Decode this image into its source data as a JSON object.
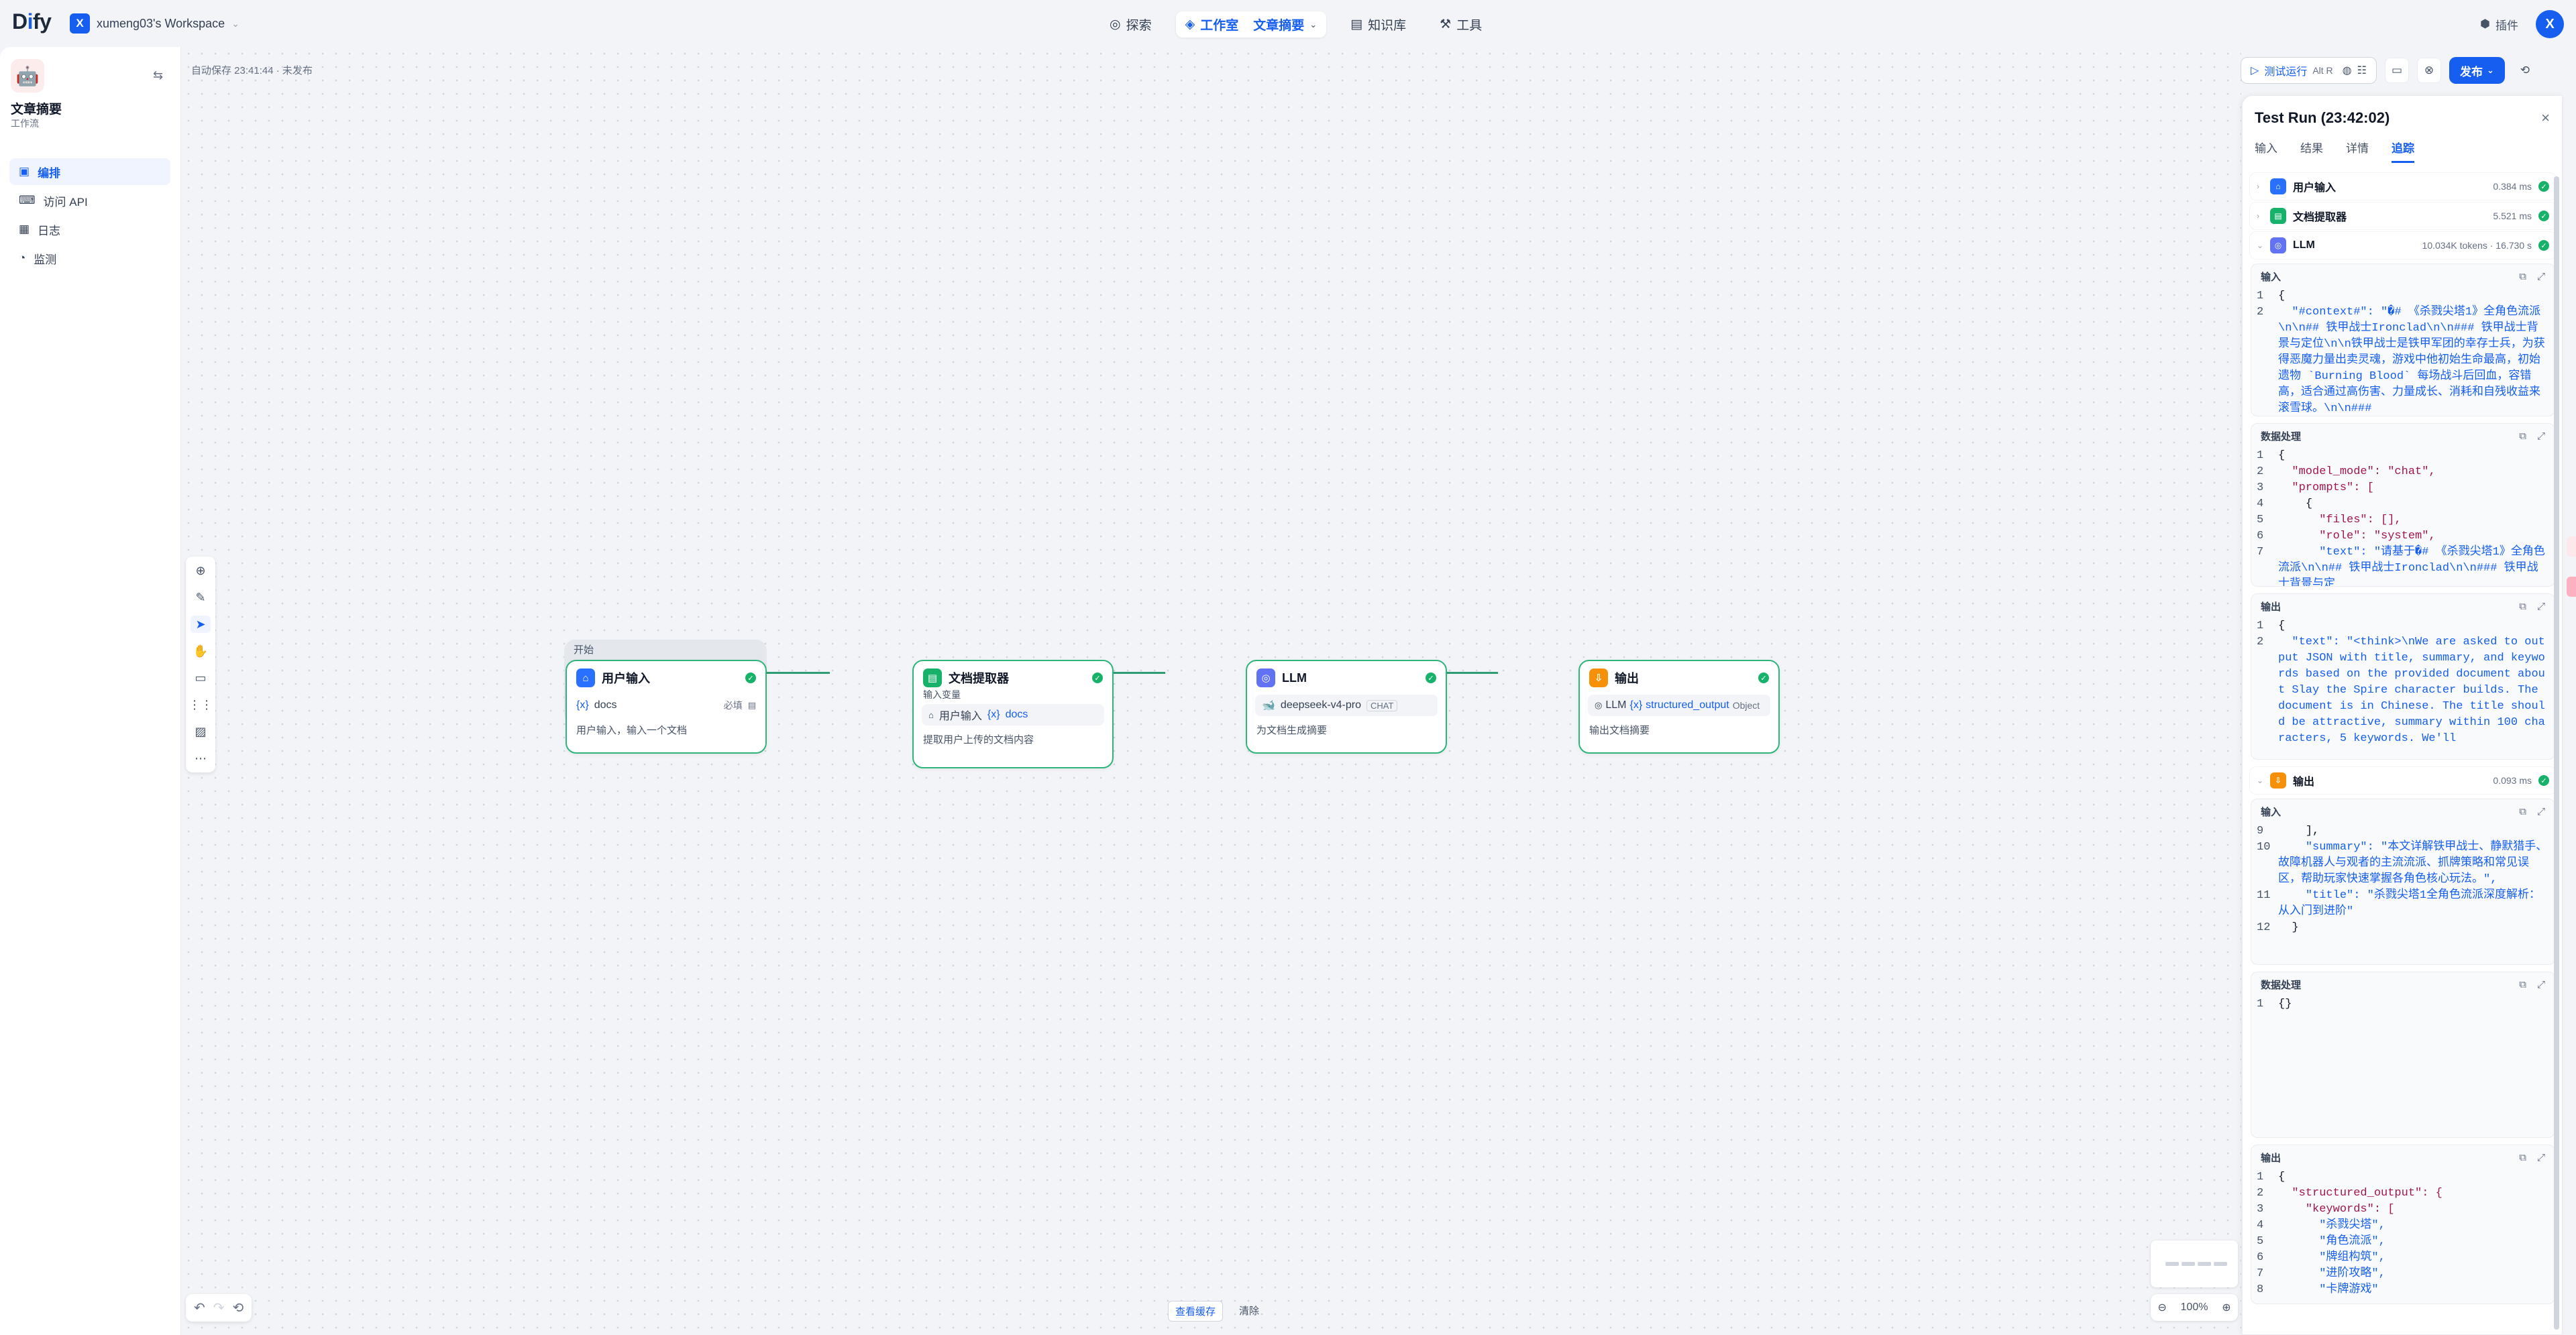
{
  "header": {
    "logo": "Dify",
    "workspace_badge": "X",
    "workspace_name": "xumeng03's Workspace",
    "nav": [
      {
        "label": "探索",
        "icon": "compass-icon"
      },
      {
        "label": "工作室",
        "icon": "studio-icon",
        "sub": "文章摘要"
      },
      {
        "label": "知识库",
        "icon": "book-icon"
      },
      {
        "label": "工具",
        "icon": "tool-icon"
      }
    ],
    "plugins_label": "插件",
    "avatar": "X"
  },
  "sidebar": {
    "app_name": "文章摘要",
    "app_type": "工作流",
    "items": [
      {
        "label": "编排",
        "icon": "layout-icon",
        "active": true
      },
      {
        "label": "访问 API",
        "icon": "terminal-icon",
        "active": false
      },
      {
        "label": "日志",
        "icon": "file-icon",
        "active": false
      },
      {
        "label": "监测",
        "icon": "monitor-icon",
        "active": false
      }
    ]
  },
  "canvas": {
    "autosave": "自动保存 23:41:44 · 未发布",
    "bottom_view_cache": "查看缓存",
    "bottom_clear": "清除",
    "zoom": "100%",
    "start_group_label": "开始",
    "nodes": {
      "user_input": {
        "title": "用户输入",
        "var": "docs",
        "required": "必填",
        "desc": "用户输入，输入一个文档",
        "color": "#2970ff"
      },
      "doc_extractor": {
        "title": "文档提取器",
        "input_label": "输入变量",
        "source": "用户输入",
        "var": "docs",
        "desc": "提取用户上传的文档内容",
        "color": "#17b26a"
      },
      "llm": {
        "title": "LLM",
        "model": "deepseek-v4-pro",
        "mode": "CHAT",
        "desc": "为文档生成摘要",
        "color": "#6172f3"
      },
      "output": {
        "title": "输出",
        "source": "LLM",
        "var": "structured_output",
        "type": "Object",
        "desc": "输出文档摘要",
        "color": "#f79009"
      }
    }
  },
  "right_tools": {
    "test_run": "测试运行",
    "shortcut": "Alt R",
    "publish": "发布"
  },
  "panel": {
    "title": "Test Run (23:42:02)",
    "tabs": [
      "输入",
      "结果",
      "详情",
      "追踪"
    ],
    "active_tab": "追踪",
    "trace": [
      {
        "name": "用户输入",
        "time": "0.384 ms",
        "color": "#2970ff"
      },
      {
        "name": "文档提取器",
        "time": "5.521 ms",
        "color": "#17b26a"
      },
      {
        "name": "LLM",
        "time": "10.034K tokens · 16.730 s",
        "color": "#6172f3"
      },
      {
        "name": "输出",
        "time": "0.093 ms",
        "color": "#f79009"
      }
    ],
    "llm_input_label": "输入",
    "llm_process_label": "数据处理",
    "llm_output_label": "输出",
    "out_input_label": "输入",
    "out_process_label": "数据处理",
    "out_output_label": "输出",
    "llm_input_lines": [
      {
        "n": "1",
        "t": "{"
      },
      {
        "n": "2",
        "t": "  \"#context#\": \"�# 《杀戮尖塔1》全角色流派\\n\\n## 铁甲战士Ironclad\\n\\n### 铁甲战士背景与定位\\n\\n铁甲战士是铁甲军团的幸存士兵，为获得恶魔力量出卖灵魂，游戏中他初始生命最高，初始遗物 `Burning Blood` 每场战斗后回血，容错高，适合通过高伤害、力量成长、消耗和自残收益来滚雪球。\\n\\n###"
      }
    ],
    "llm_process_lines": [
      {
        "n": "1",
        "t": "{"
      },
      {
        "n": "2",
        "t": "  \"model_mode\": \"chat\","
      },
      {
        "n": "3",
        "t": "  \"prompts\": ["
      },
      {
        "n": "4",
        "t": "    {"
      },
      {
        "n": "5",
        "t": "      \"files\": [],"
      },
      {
        "n": "6",
        "t": "      \"role\": \"system\","
      },
      {
        "n": "7",
        "t": "      \"text\": \"请基于�# 《杀戮尖塔1》全角色流派\\n\\n## 铁甲战士Ironclad\\n\\n### 铁甲战士背景与定"
      }
    ],
    "llm_output_lines": [
      {
        "n": "1",
        "t": "{"
      },
      {
        "n": "2",
        "t": "  \"text\": \"<think>\\nWe are asked to output JSON with title, summary, and keywords based on the provided document about Slay the Spire character builds. The document is in Chinese. The title should be attractive, summary within 100 characters, 5 keywords. We'll"
      }
    ],
    "out_input_lines": [
      {
        "n": "9",
        "t": "    ],"
      },
      {
        "n": "10",
        "t": "    \"summary\": \"本文详解铁甲战士、静默猎手、故障机器人与观者的主流流派、抓牌策略和常见误区，帮助玩家快速掌握各角色核心玩法。\","
      },
      {
        "n": "11",
        "t": "    \"title\": \"杀戮尖塔1全角色流派深度解析：从入门到进阶\""
      },
      {
        "n": "12",
        "t": "  }"
      }
    ],
    "out_process_lines": [
      {
        "n": "1",
        "t": "{}"
      }
    ],
    "out_output_lines": [
      {
        "n": "1",
        "t": "{"
      },
      {
        "n": "2",
        "t": "  \"structured_output\": {"
      },
      {
        "n": "3",
        "t": "    \"keywords\": ["
      },
      {
        "n": "4",
        "t": "      \"杀戮尖塔\","
      },
      {
        "n": "5",
        "t": "      \"角色流派\","
      },
      {
        "n": "6",
        "t": "      \"牌组构筑\","
      },
      {
        "n": "7",
        "t": "      \"进阶攻略\","
      },
      {
        "n": "8",
        "t": "      \"卡牌游戏\""
      }
    ]
  }
}
